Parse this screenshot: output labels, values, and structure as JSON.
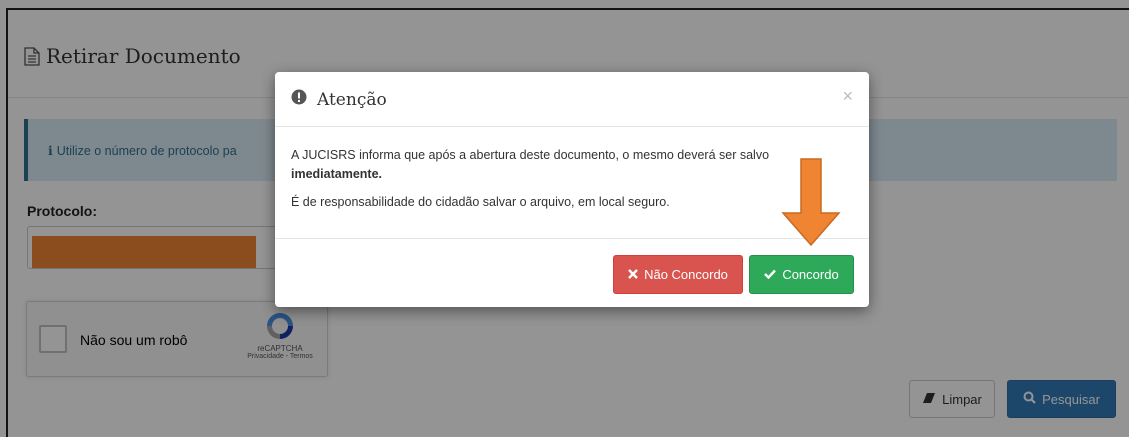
{
  "page": {
    "title": "Retirar Documento",
    "info_text": "Utilize o número de protocolo pa",
    "protocol_label": "Protocolo:",
    "protocol_value": "",
    "recaptcha": {
      "label": "Não sou um robô",
      "brand": "reCAPTCHA",
      "links": "Privacidade - Termos"
    },
    "buttons": {
      "clear": "Limpar",
      "search": "Pesquisar"
    }
  },
  "modal": {
    "title": "Atenção",
    "close": "×",
    "p1_text": "A JUCISRS informa que após a abertura deste documento, o mesmo deverá ser salvo ",
    "p1_bold_end": "imediatamente.",
    "p2": "É de responsabilidade do cidadão salvar o arquivo, em local seguro.",
    "disagree_label": "Não Concordo",
    "agree_label": "Concordo"
  },
  "colors": {
    "annotation": "#ef8532",
    "info_bg": "#d9edf7",
    "danger": "#d9534f",
    "success": "#2ea95a",
    "primary": "#337ab7"
  },
  "icons": {
    "page_title": "document-icon",
    "info": "info-icon",
    "modal_title": "exclamation-circle-icon",
    "close": "close-icon",
    "disagree": "x-icon",
    "agree": "check-icon",
    "clear": "eraser-icon",
    "search": "search-icon"
  }
}
